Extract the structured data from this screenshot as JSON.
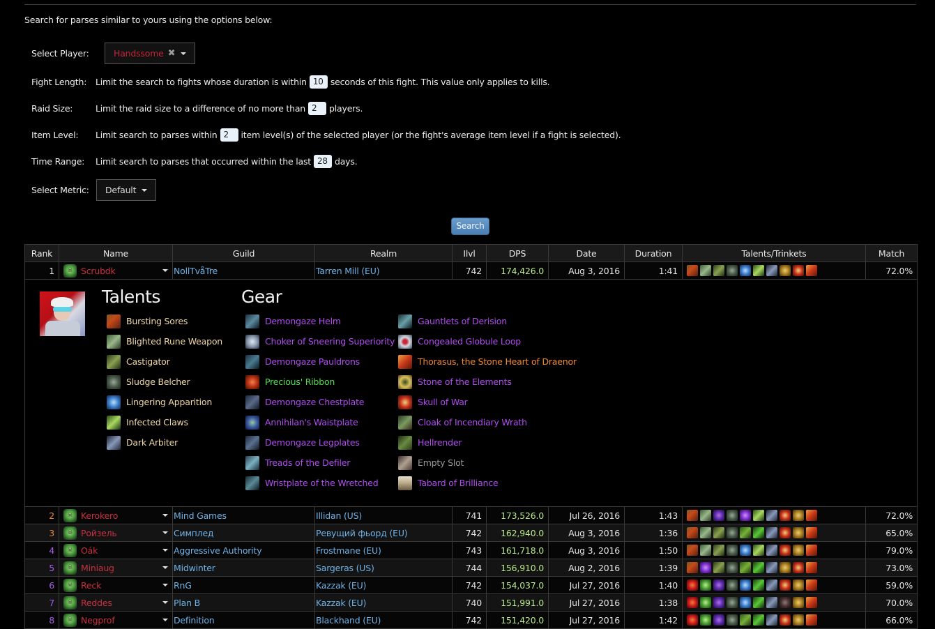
{
  "intro": "Search for parses similar to yours using the options below:",
  "options": {
    "select_player": {
      "label": "Select Player:",
      "value": "Handssome",
      "clear_icon": "✖"
    },
    "fight_length": {
      "label": "Fight Length:",
      "pre": "Limit the search to fights whose duration is within",
      "value": "10",
      "post": "seconds of this fight. This value only applies to kills."
    },
    "raid_size": {
      "label": "Raid Size:",
      "pre": "Limit the raid size to a difference of no more than",
      "value": "2",
      "post": "players."
    },
    "item_level": {
      "label": "Item Level:",
      "pre": "Limit search to parses within",
      "value": "2",
      "post": "item level(s) of the selected player (or the fight's average item level if a fight is selected)."
    },
    "time_range": {
      "label": "Time Range:",
      "pre": "Limit search to parses that occurred within the last",
      "value": "28",
      "post": "days."
    },
    "select_metric": {
      "label": "Select Metric:",
      "value": "Default"
    }
  },
  "search_button": "Search",
  "colors": {
    "player_class": "#c8303f",
    "link": "#6fb2e6",
    "dps": "#b8e68a",
    "epic": "#b04cf0",
    "uncommon": "#4fe04a",
    "legendary": "#f08830",
    "talent": "#efd8a6",
    "rank_orange": "#e8863a",
    "rank_purple": "#a65ee8",
    "search_button": "#5a8ec2"
  },
  "table": {
    "headers": [
      "Rank",
      "Name",
      "Guild",
      "Realm",
      "Ilvl",
      "DPS",
      "Date",
      "Duration",
      "Talents/Trinkets",
      "Match"
    ],
    "rows": [
      {
        "rank": "1",
        "rank_color": "#e8e8e8",
        "name": "Scrubdk",
        "guild": "NollTvåTre",
        "realm": "Tarren Mill (EU)",
        "ilvl": "742",
        "dps": "174,426.0",
        "date": "Aug 3, 2016",
        "duration": "1:41",
        "match": "72.0%",
        "icons": [
          "bursting-sores",
          "blighted-rune-weapon",
          "castigator",
          "sludge-belcher",
          "lingering-apparition",
          "infected-claws",
          "dark-arbiter",
          "stone-of-the-elements",
          "skull-of-war",
          "thorasus"
        ]
      },
      {
        "rank": "2",
        "rank_color": "#e8863a",
        "name": "Kerokero",
        "guild": "Mind Games",
        "realm": "Illidan (US)",
        "ilvl": "741",
        "dps": "173,526.0",
        "date": "Jul 26, 2016",
        "duration": "1:43",
        "match": "72.0%",
        "icons": [
          "bursting-sores",
          "blighted-rune-weapon",
          "shadow-infusion",
          "sludge-belcher",
          "purple-talent",
          "infected-claws",
          "dark-arbiter",
          "skull-of-war",
          "stone-of-the-elements",
          "thorasus"
        ]
      },
      {
        "rank": "3",
        "rank_color": "#e8863a",
        "name": "Ройзель",
        "guild": "Симплед",
        "realm": "Ревущий фьорд (EU)",
        "ilvl": "742",
        "dps": "162,940.0",
        "date": "Aug 3, 2016",
        "duration": "1:36",
        "match": "65.0%",
        "icons": [
          "bursting-sores",
          "blighted-rune-weapon",
          "castigator",
          "sludge-belcher",
          "green-talent",
          "green-claw",
          "dark-arbiter",
          "skull-of-war",
          "stone-of-the-elements",
          "thorasus"
        ]
      },
      {
        "rank": "4",
        "rank_color": "#a65ee8",
        "name": "Oák",
        "guild": "Aggressive Authority",
        "realm": "Frostmane (EU)",
        "ilvl": "743",
        "dps": "161,718.0",
        "date": "Aug 3, 2016",
        "duration": "1:50",
        "match": "79.0%",
        "icons": [
          "bursting-sores",
          "blighted-rune-weapon",
          "castigator",
          "sludge-belcher",
          "lingering-apparition",
          "infected-claws",
          "dark-arbiter",
          "skull-of-war",
          "stone-of-the-elements",
          "thorasus"
        ]
      },
      {
        "rank": "5",
        "rank_color": "#a65ee8",
        "name": "Miniaug",
        "guild": "Midwinter",
        "realm": "Sargeras (US)",
        "ilvl": "744",
        "dps": "156,910.0",
        "date": "Aug 2, 2016",
        "duration": "1:39",
        "match": "73.0%",
        "icons": [
          "bursting-sores",
          "purple-talent",
          "castigator",
          "sludge-belcher",
          "green-talent",
          "green-claw",
          "dark-arbiter",
          "stone-of-the-elements",
          "skull-of-war",
          "thorasus"
        ]
      },
      {
        "rank": "6",
        "rank_color": "#a65ee8",
        "name": "Reck",
        "guild": "RnG",
        "realm": "Kazzak (EU)",
        "ilvl": "742",
        "dps": "154,037.0",
        "date": "Jul 27, 2016",
        "duration": "1:40",
        "match": "59.0%",
        "icons": [
          "red-talent",
          "green-skull",
          "shadow-infusion",
          "sludge-belcher",
          "lingering-apparition",
          "green-claw",
          "dark-arbiter",
          "skull-of-war",
          "stone-of-the-elements",
          "thorasus"
        ]
      },
      {
        "rank": "7",
        "rank_color": "#a65ee8",
        "name": "Reddes",
        "guild": "Plan B",
        "realm": "Kazzak (EU)",
        "ilvl": "740",
        "dps": "151,991.0",
        "date": "Jul 27, 2016",
        "duration": "1:38",
        "match": "70.0%",
        "icons": [
          "red-talent",
          "green-skull",
          "shadow-infusion",
          "sludge-belcher",
          "lingering-apparition",
          "green-claw",
          "dark-arbiter",
          "dark-trinket",
          "stone-of-the-elements",
          "thorasus"
        ]
      },
      {
        "rank": "8",
        "rank_color": "#a65ee8",
        "name": "Negprof",
        "guild": "Definition",
        "realm": "Blackhand (EU)",
        "ilvl": "742",
        "dps": "151,420.0",
        "date": "Jul 27, 2016",
        "duration": "1:42",
        "match": "66.0%",
        "icons": [
          "red-talent",
          "green-skull",
          "shadow-infusion",
          "sludge-belcher",
          "green-talent",
          "green-claw",
          "dark-arbiter",
          "skull-of-war",
          "stone-of-the-elements",
          "thorasus"
        ]
      }
    ]
  },
  "detail": {
    "talents_title": "Talents",
    "gear_title": "Gear",
    "talents": [
      {
        "name": "Bursting Sores",
        "icon": "bursting-sores"
      },
      {
        "name": "Blighted Rune Weapon",
        "icon": "blighted-rune-weapon"
      },
      {
        "name": "Castigator",
        "icon": "castigator"
      },
      {
        "name": "Sludge Belcher",
        "icon": "sludge-belcher"
      },
      {
        "name": "Lingering Apparition",
        "icon": "lingering-apparition"
      },
      {
        "name": "Infected Claws",
        "icon": "infected-claws"
      },
      {
        "name": "Dark Arbiter",
        "icon": "dark-arbiter"
      }
    ],
    "gear_col1": [
      {
        "name": "Demongaze Helm",
        "quality": "epic"
      },
      {
        "name": "Choker of Sneering Superiority",
        "quality": "epic"
      },
      {
        "name": "Demongaze Pauldrons",
        "quality": "epic"
      },
      {
        "name": "Precious' Ribbon",
        "quality": "rare-green"
      },
      {
        "name": "Demongaze Chestplate",
        "quality": "epic"
      },
      {
        "name": "Annihilan's Waistplate",
        "quality": "epic"
      },
      {
        "name": "Demongaze Legplates",
        "quality": "epic"
      },
      {
        "name": "Treads of the Defiler",
        "quality": "epic"
      },
      {
        "name": "Wristplate of the Wretched",
        "quality": "epic"
      }
    ],
    "gear_col2": [
      {
        "name": "Gauntlets of Derision",
        "quality": "epic"
      },
      {
        "name": "Congealed Globule Loop",
        "quality": "epic"
      },
      {
        "name": "Thorasus, the Stone Heart of Draenor",
        "quality": "legendary"
      },
      {
        "name": "Stone of the Elements",
        "quality": "epic"
      },
      {
        "name": "Skull of War",
        "quality": "epic"
      },
      {
        "name": "Cloak of Incendiary Wrath",
        "quality": "epic"
      },
      {
        "name": "Hellrender",
        "quality": "epic"
      },
      {
        "name": "Empty Slot",
        "quality": "empty"
      },
      {
        "name": "Tabard of Brilliance",
        "quality": "epic"
      }
    ]
  }
}
